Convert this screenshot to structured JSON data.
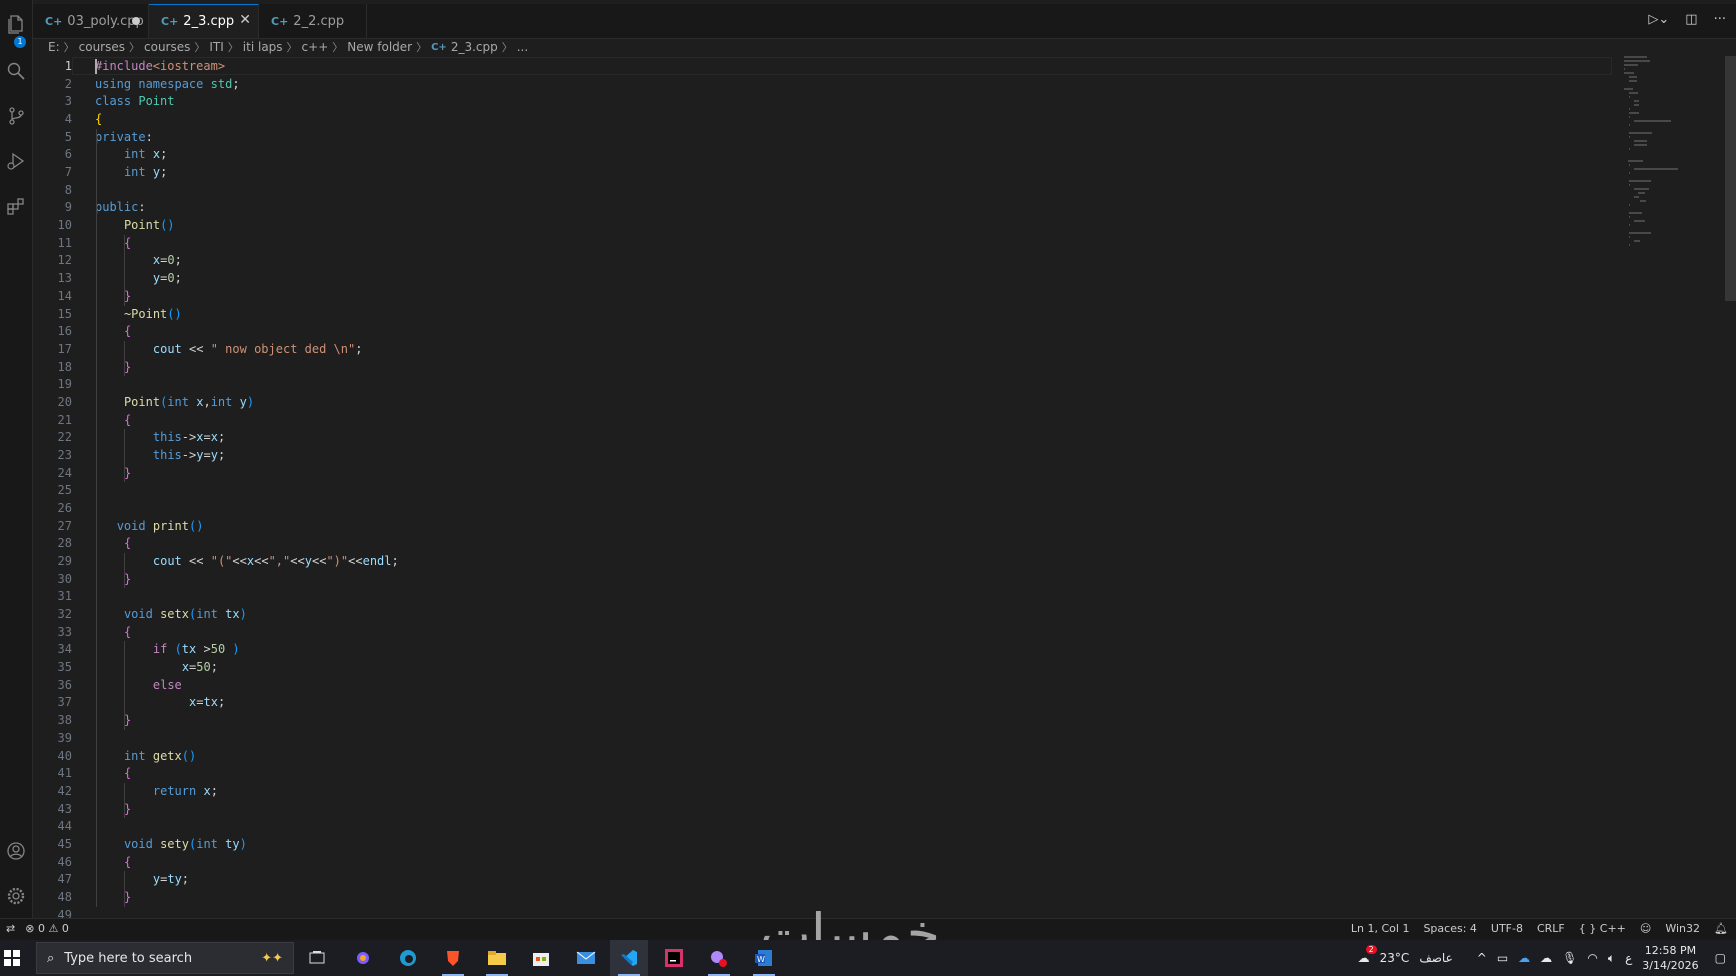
{
  "tabs": [
    {
      "label": "03_poly.cpp",
      "modified": true,
      "active": false
    },
    {
      "label": "2_3.cpp",
      "modified": false,
      "active": true
    },
    {
      "label": "2_2.cpp",
      "modified": false,
      "active": false
    }
  ],
  "breadcrumb": [
    "E:",
    "courses",
    "courses",
    "ITI",
    "iti laps",
    "c++",
    "New folder",
    "2_3.cpp",
    "..."
  ],
  "explorer_badge": "1",
  "current_line": "1",
  "code_lines": [
    "#include<iostream>",
    "using namespace std;",
    "class Point",
    "{",
    "private:",
    "    int x;",
    "    int y;",
    "",
    "public:",
    "    Point()",
    "    {",
    "        x=0;",
    "        y=0;",
    "    }",
    "    ~Point()",
    "    {",
    "        cout << \" now object ded \\n\";",
    "    }",
    "",
    "    Point(int x,int y)",
    "    {",
    "        this->x=x;",
    "        this->y=y;",
    "    }",
    "",
    "",
    "   void print()",
    "    {",
    "        cout << \"(\"<<x<<\",\"<<y<<\")\"<<endl;",
    "    }",
    "",
    "    void setx(int tx)",
    "    {",
    "        if (tx >50 )",
    "            x=50;",
    "        else",
    "             x=tx;",
    "    }",
    "",
    "    int getx()",
    "    {",
    "        return x;",
    "    }",
    "",
    "    void sety(int ty)",
    "    {",
    "        y=ty;",
    "    }",
    ""
  ],
  "status": {
    "errors": "0",
    "warnings": "0",
    "position": "Ln 1, Col 1",
    "spaces": "Spaces: 4",
    "encoding": "UTF-8",
    "eol": "CRLF",
    "language": "C++",
    "platform": "Win32"
  },
  "taskbar": {
    "search_placeholder": "Type here to search",
    "weather": "23°C",
    "weather_desc": "عاصف",
    "input_lang": "ع",
    "time": "12:58 PM",
    "date": "3/14/2026",
    "notification_count": "2"
  },
  "watermark": "خمسات",
  "colors": {
    "editor_bg": "#1e1e1e",
    "accent": "#0078d4",
    "keyword": "#569cd6",
    "control": "#c586c0",
    "type": "#4ec9b0",
    "function": "#dcdcaa",
    "variable": "#9cdcfe",
    "string": "#ce9178",
    "number": "#b5cea8"
  }
}
